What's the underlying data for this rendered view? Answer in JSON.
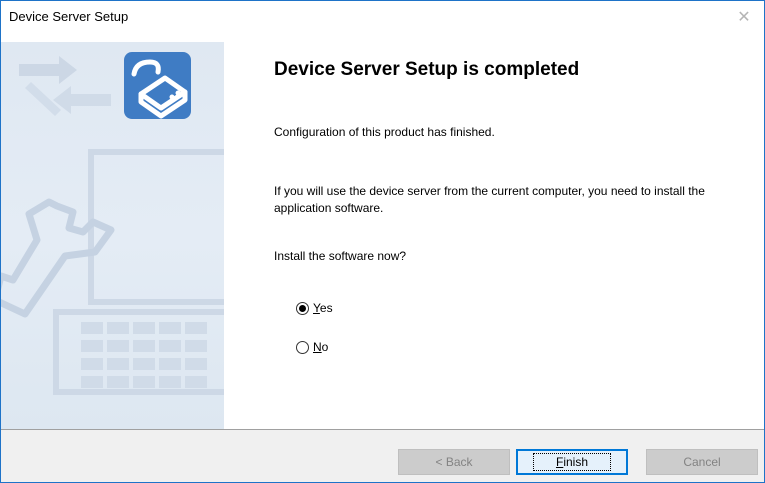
{
  "window": {
    "title": "Device Server Setup",
    "close_glyph": "✕"
  },
  "content": {
    "heading": "Device Server Setup is completed",
    "configuration_text": "Configuration of this product has finished.",
    "info_text": "If you will use the device server from the current computer, you need to install the application software.",
    "question": "Install the software now?",
    "options": [
      {
        "label": "Yes",
        "selected": true
      },
      {
        "label": "No",
        "selected": false
      }
    ]
  },
  "buttons": {
    "back_label": "< Back",
    "finish_label": "Finish",
    "cancel_label": "Cancel"
  },
  "colors": {
    "sidebar_bg": "#e1e9f3",
    "icon_blue": "#3f7cc4",
    "default_button_border": "#0078d7",
    "window_border": "#1e73c8"
  },
  "icons": [
    "usb-device-icon",
    "transfer-arrows-icon",
    "wrench-icon",
    "laptop-icon"
  ]
}
